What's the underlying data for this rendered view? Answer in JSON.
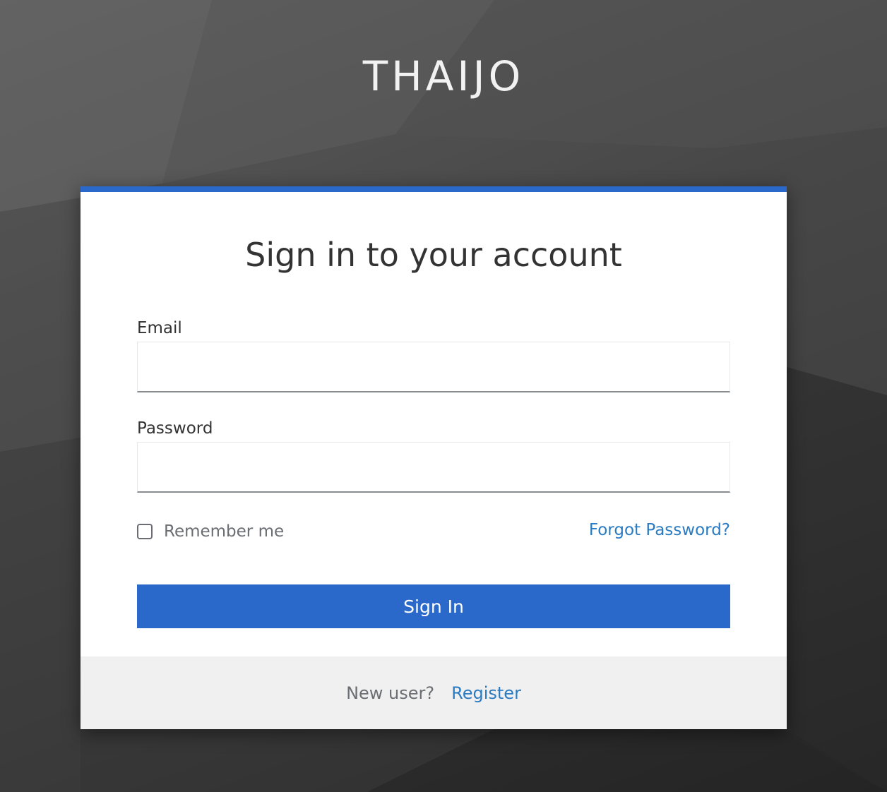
{
  "brand": {
    "name": "THAIJO"
  },
  "login": {
    "title": "Sign in to your account",
    "email_label": "Email",
    "email_value": "",
    "password_label": "Password",
    "password_value": "",
    "remember_label": "Remember me",
    "remember_checked": false,
    "forgot_label": "Forgot Password?",
    "submit_label": "Sign In"
  },
  "footer": {
    "new_user_text": "New user?",
    "register_label": "Register"
  },
  "colors": {
    "accent": "#2a69c9",
    "link": "#2a7bc2",
    "background": "#3a3a3a",
    "card": "#ffffff",
    "footer_bg": "#f0f0f0"
  }
}
